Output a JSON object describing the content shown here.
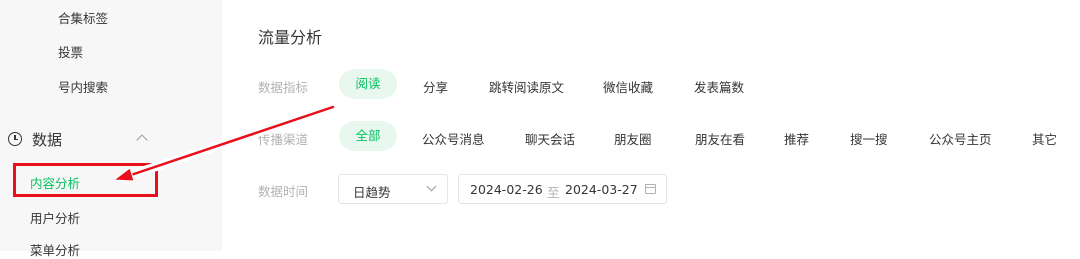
{
  "sidebar": {
    "items_top": [
      "合集标签",
      "投票",
      "号内搜索"
    ],
    "group": {
      "label": "数据",
      "icon": "clock-icon",
      "chevron": "chevron-up-icon"
    },
    "items_sub": [
      "内容分析",
      "用户分析",
      "菜单分析"
    ],
    "active_item": "内容分析"
  },
  "main": {
    "title": "流量分析",
    "metrics": {
      "label": "数据指标",
      "options": [
        "阅读",
        "分享",
        "跳转阅读原文",
        "微信收藏",
        "发表篇数"
      ],
      "selected": "阅读"
    },
    "channels": {
      "label": "传播渠道",
      "options": [
        "全部",
        "公众号消息",
        "聊天会话",
        "朋友圈",
        "朋友在看",
        "推荐",
        "搜一搜",
        "公众号主页",
        "其它"
      ],
      "selected": "全部"
    },
    "time": {
      "label": "数据时间",
      "mode_value": "日趋势",
      "date_start": "2024-02-26",
      "date_separator": "至",
      "date_end": "2024-03-27"
    }
  },
  "colors": {
    "accent_green": "#07c160",
    "pill_bg": "#e8f8ef",
    "annotation_red": "#e8111b",
    "sidebar_bg": "#f7f7f7",
    "muted_text": "#b2b2b2"
  }
}
